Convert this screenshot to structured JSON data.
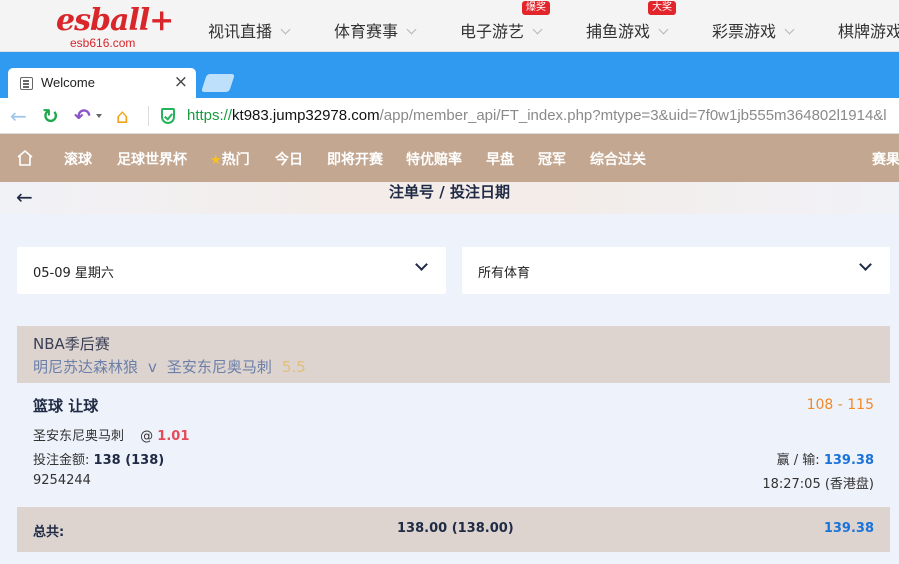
{
  "site": {
    "logo_text": "esball+",
    "logo_sub": "esb616.com",
    "nav": [
      {
        "label": "视讯直播",
        "badge": ""
      },
      {
        "label": "体育赛事",
        "badge": ""
      },
      {
        "label": "电子游艺",
        "badge": "爆奖"
      },
      {
        "label": "捕鱼游戏",
        "badge": "大奖"
      },
      {
        "label": "彩票游戏",
        "badge": ""
      },
      {
        "label": "棋牌游戏",
        "badge": ""
      }
    ]
  },
  "browser": {
    "tab_title": "Welcome",
    "tab_close": "×",
    "url_scheme": "https://",
    "url_host": "kt983.jump32978.com",
    "url_path": "/app/member_api/FT_index.php?mtype=3&uid=7f0w1jb555m364802l1914&l"
  },
  "sportnav": {
    "items": [
      "滚球",
      "足球世界杯",
      "热门",
      "今日",
      "即将开赛",
      "特优赔率",
      "早盘",
      "冠军",
      "综合过关",
      "赛果"
    ]
  },
  "page": {
    "title": "注单号 / 投注日期",
    "back": "←",
    "date_select": "05-09 星期六",
    "sport_select": "所有体育"
  },
  "bet": {
    "league": "NBA季后赛",
    "home_team": "明尼苏达森林狼",
    "vs": "v",
    "away_team": "圣安东尼奥马刺",
    "handicap": "5.5",
    "bet_type": "篮球 让球",
    "score": "108 - 115",
    "pick": "圣安东尼奥马刺",
    "at": "@",
    "odds": "1.01",
    "stake_label": "投注金额:",
    "stake_value": "138 (138)",
    "winloss_label": "赢 / 输:",
    "winloss_value": "139.38",
    "ticket_id": "9254244",
    "time": "18:27:05 (香港盘)"
  },
  "total": {
    "label": "总共:",
    "stake": "138.00 (138.00)",
    "win": "139.38"
  },
  "colors": {
    "brand_red": "#d8262b",
    "tabbar_blue": "#2f9af0",
    "sportnav_tan": "#c4a791",
    "odds_red": "#e44b57",
    "score_orange": "#f08a27",
    "win_blue": "#1a73d9"
  }
}
